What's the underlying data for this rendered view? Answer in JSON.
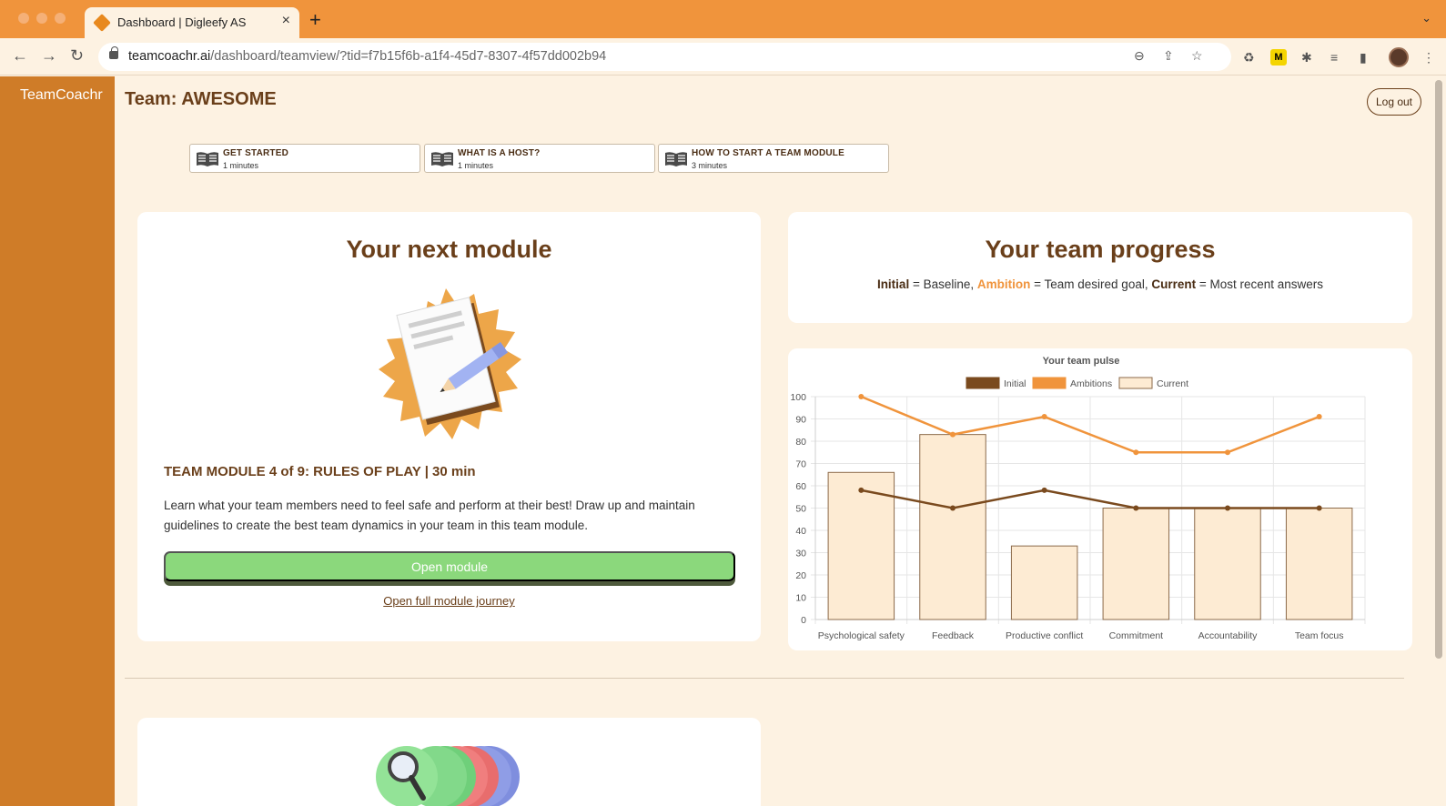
{
  "browser": {
    "tab_title": "Dashboard | Digleefy AS",
    "url_host": "teamcoachr.ai",
    "url_path": "/dashboard/teamview/?tid=f7b15f6b-a1f4-45d7-8307-4f57dd002b94"
  },
  "sidebar": {
    "brand": "TeamCoachr"
  },
  "header": {
    "team_title": "Team: AWESOME",
    "logout_label": "Log out"
  },
  "guides": [
    {
      "title": "GET STARTED",
      "duration": "1 minutes"
    },
    {
      "title": "WHAT IS A HOST?",
      "duration": "1 minutes"
    },
    {
      "title": "HOW TO START A TEAM MODULE",
      "duration": "3 minutes"
    }
  ],
  "next_module": {
    "heading": "Your next module",
    "title": "TEAM MODULE 4 of 9: RULES OF PLAY | 30 min",
    "description": "Learn what your team members need to feel safe and perform at their best! Draw up and maintain guidelines to create the best team dynamics in your team in this team module.",
    "open_button": "Open module",
    "journey_link": "Open full module journey"
  },
  "team_progress": {
    "heading": "Your team progress",
    "legend_initial": "Initial",
    "legend_initial_desc": " = Baseline, ",
    "legend_ambition": "Ambition",
    "legend_ambition_desc": " = Team desired goal, ",
    "legend_current": "Current",
    "legend_current_desc": " = Most recent answers"
  },
  "colors": {
    "sidebar": "#cf7c28",
    "tabbar": "#f0943c",
    "page_bg": "#fdf2e2",
    "initial": "#7a4a1e",
    "ambition": "#f0943c",
    "current_fill": "#fdebd3",
    "current_stroke": "#8b6a4a",
    "button": "#8bd87c"
  },
  "chart_data": {
    "type": "bar",
    "title": "Your team pulse",
    "categories": [
      "Psychological safety",
      "Feedback",
      "Productive conflict",
      "Commitment",
      "Accountability",
      "Team focus"
    ],
    "ylim": [
      0,
      100
    ],
    "yticks": [
      "0",
      "10",
      "20",
      "30",
      "40",
      "50",
      "60",
      "70",
      "80",
      "90",
      "100"
    ],
    "legend_position": "top",
    "grid": true,
    "series": [
      {
        "name": "Initial",
        "type": "line",
        "values": [
          58,
          50,
          58,
          50,
          50,
          50
        ]
      },
      {
        "name": "Ambitions",
        "type": "line",
        "values": [
          100,
          83,
          91,
          75,
          75,
          91
        ]
      },
      {
        "name": "Current",
        "type": "bar",
        "values": [
          66,
          83,
          33,
          50,
          50,
          50
        ]
      }
    ]
  }
}
